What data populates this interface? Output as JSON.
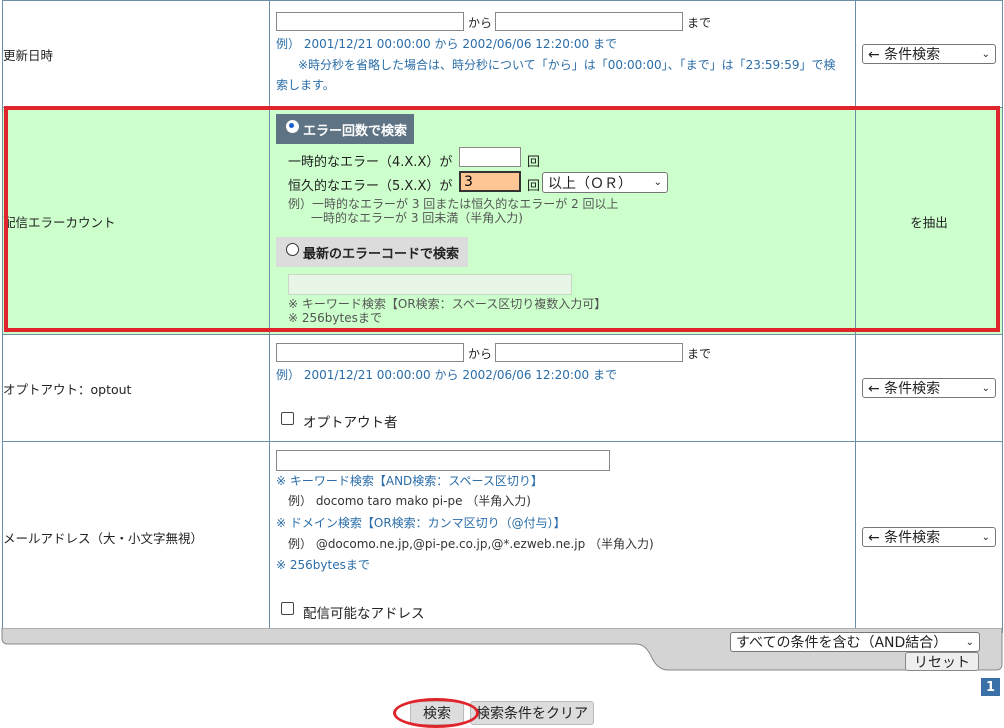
{
  "date_range": {
    "label": "更新日時",
    "from_word": "から",
    "to_word": "まで",
    "example": "例） 2001/12/21 00:00:00 から 2002/06/06 12:20:00 まで",
    "note_line1": "※時分秒を省略した場合は、時分秒について「から」は「00:00:00」、「まで」は「23:59:59」で検",
    "note_line2": "索します。",
    "condition_select": "← 条件検索"
  },
  "error_count": {
    "label": "配信エラーカウント",
    "tab_count": "エラー回数で検索",
    "temp_label": "一時的なエラー（4.X.X）が",
    "temp_value": "",
    "perm_label": "恒久的なエラー（5.X.X）が",
    "perm_value": "3",
    "times_unit": "回",
    "logic_select": "以上（ＯＲ）",
    "example_line1": "例）一時的なエラーが 3 回または恒久的なエラーが 2 回以上",
    "example_line2": "一時的なエラーが 3 回未満（半角入力)",
    "tab_code": "最新のエラーコードで検索",
    "code_value": "",
    "code_note1": "※ キーワード検索【OR検索：スペース区切り複数入力可】",
    "code_note2": "※ 256bytesまで",
    "action": "を抽出",
    "highlight_color": "#e0242c",
    "bg_color": "#ccffcc"
  },
  "optout": {
    "label": "オプトアウト：optout",
    "from_word": "から",
    "to_word": "まで",
    "example": "例） 2001/12/21 00:00:00 から 2002/06/06 12:20:00 まで",
    "checkbox_label": "オプトアウト者",
    "condition_select": "← 条件検索"
  },
  "mail": {
    "label": "メールアドレス（大・小文字無視）",
    "note1": "※ キーワード検索【AND検索：スペース区切り】",
    "example1": "例） docomo taro mako pi-pe （半角入力)",
    "note2": "※ ドメイン検索【OR検索：カンマ区切り（@付与）】",
    "example2": "例） @docomo.ne.jp,@pi-pe.co.jp,@*.ezweb.ne.jp （半角入力)",
    "note3": "※ 256bytesまで",
    "checkbox_label": "配信可能なアドレス",
    "condition_select": "← 条件検索"
  },
  "footer": {
    "combine_select": "すべての条件を含む（AND結合）",
    "reset_button": "リセット",
    "page_number": "1",
    "search_button": "検索",
    "clear_button": "検索条件をクリア"
  }
}
